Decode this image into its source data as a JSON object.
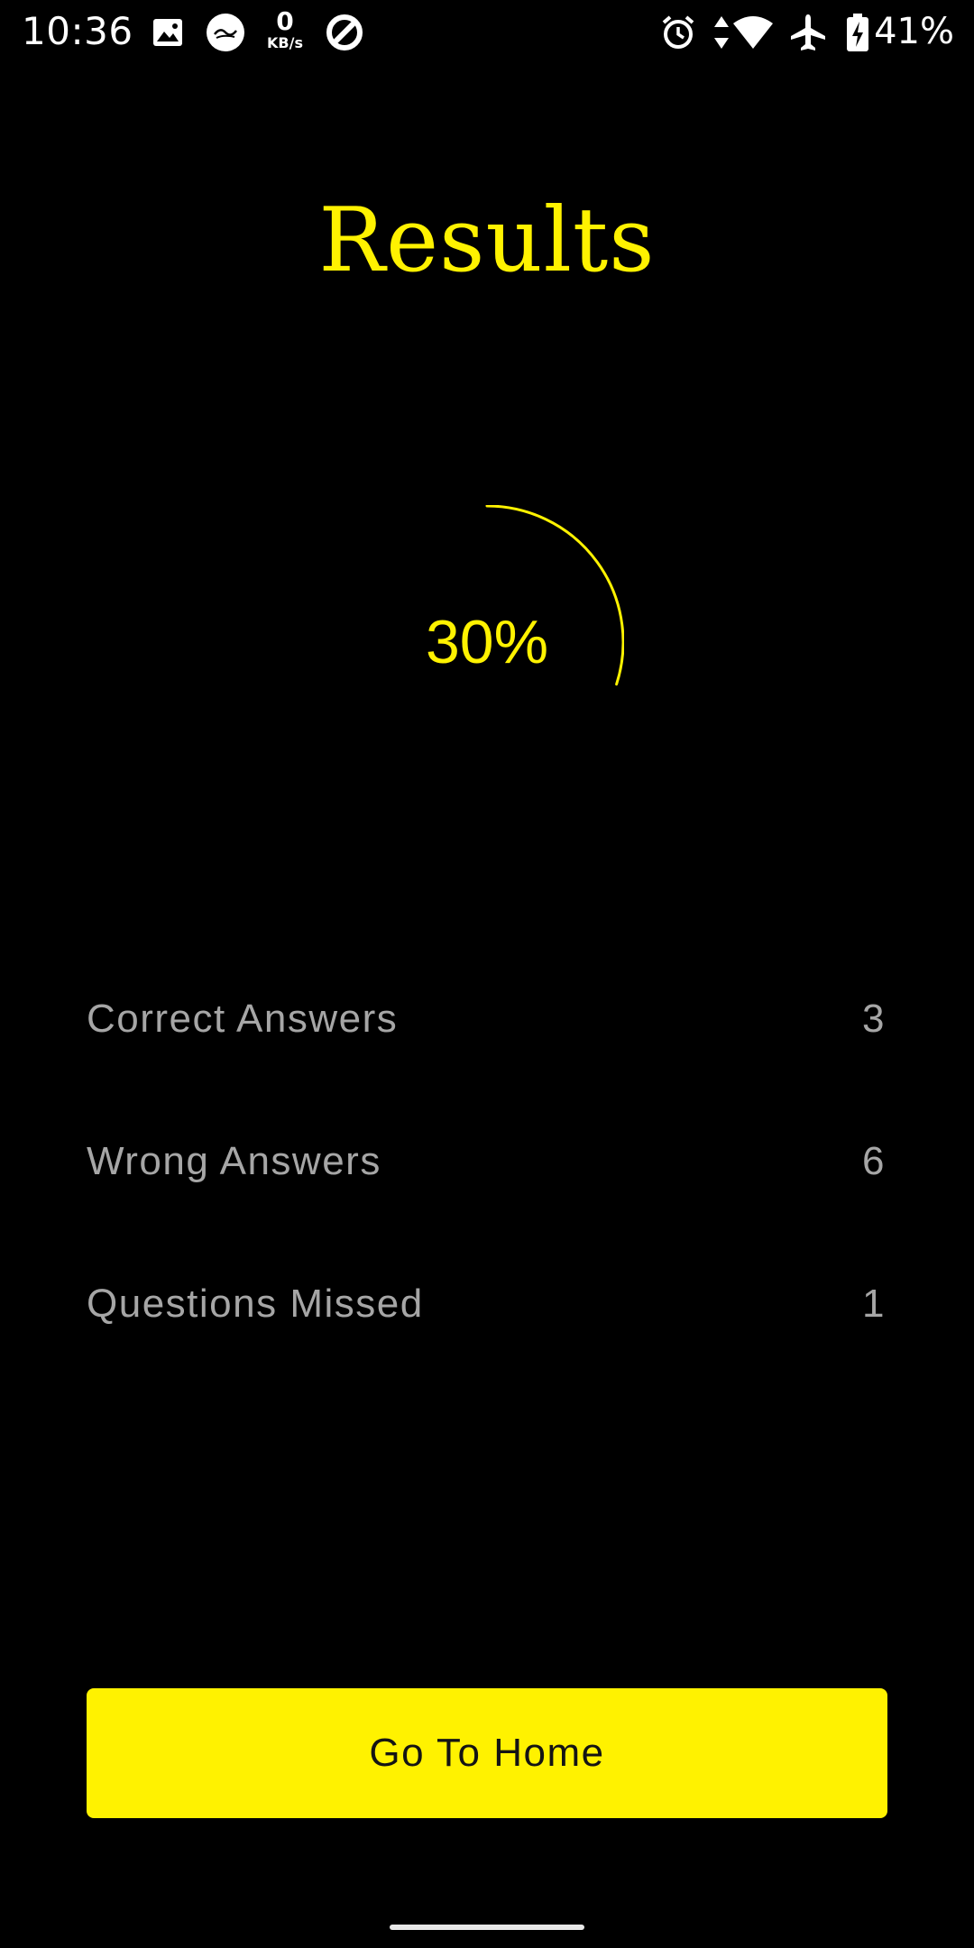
{
  "status_bar": {
    "time": "10:36",
    "netspeed_value": "0",
    "netspeed_unit": "KB/s",
    "battery": "41%",
    "icons": [
      "image-icon",
      "app-badge-icon",
      "data-saver-icon",
      "alarm-icon",
      "data-arrows-icon",
      "wifi-icon",
      "airplane-icon",
      "battery-charging-icon"
    ]
  },
  "header": {
    "title": "Results"
  },
  "progress": {
    "label": "30%",
    "value": 0.3,
    "color": "#FFF200"
  },
  "stats": [
    {
      "label": "Correct Answers",
      "value": "3"
    },
    {
      "label": "Wrong Answers",
      "value": "6"
    },
    {
      "label": "Questions Missed",
      "value": "1"
    }
  ],
  "actions": {
    "home_label": "Go To Home"
  },
  "colors": {
    "accent": "#FFF200",
    "background": "#000000",
    "muted_text": "#A6A6A6"
  }
}
